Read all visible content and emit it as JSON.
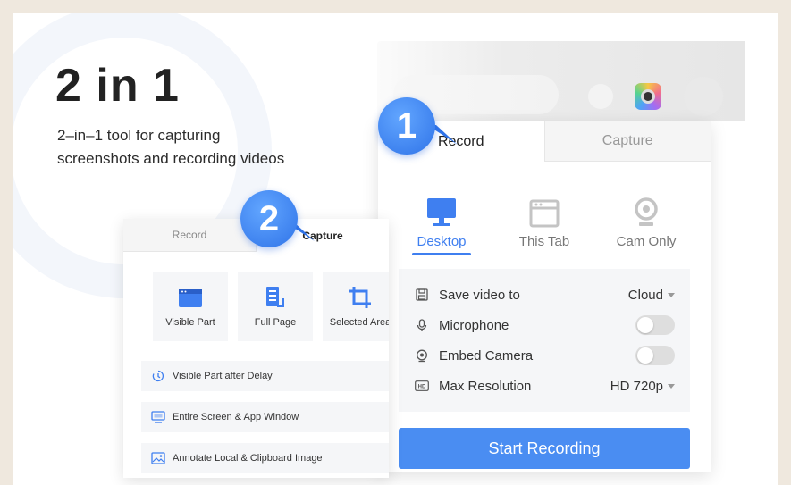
{
  "hero": {
    "title": "2 in 1",
    "subtitle_line1": "2–in–1 tool for capturing",
    "subtitle_line2": "screenshots and recording videos"
  },
  "badges": {
    "one": "1",
    "two": "2"
  },
  "record_popup": {
    "tabs": [
      {
        "label": "Record",
        "active": true
      },
      {
        "label": "Capture",
        "active": false
      }
    ],
    "modes": [
      {
        "label": "Desktop",
        "icon": "monitor-icon",
        "active": true
      },
      {
        "label": "This Tab",
        "icon": "browser-tab-icon",
        "active": false
      },
      {
        "label": "Cam Only",
        "icon": "webcam-icon",
        "active": false
      }
    ],
    "settings": [
      {
        "label": "Save video to",
        "value": "Cloud",
        "icon": "save-icon",
        "control": "dropdown"
      },
      {
        "label": "Microphone",
        "icon": "microphone-icon",
        "control": "toggle",
        "on": false
      },
      {
        "label": "Embed Camera",
        "icon": "camera-icon",
        "control": "toggle",
        "on": false
      },
      {
        "label": "Max Resolution",
        "value": "HD 720p",
        "icon": "hd-icon",
        "control": "dropdown"
      }
    ],
    "start_button": "Start Recording"
  },
  "capture_popup": {
    "tabs": [
      {
        "label": "Record",
        "active": false
      },
      {
        "label": "Capture",
        "active": true
      }
    ],
    "cards": [
      {
        "label": "Visible Part",
        "icon": "visible-part-icon"
      },
      {
        "label": "Full Page",
        "icon": "full-page-icon"
      },
      {
        "label": "Selected Area",
        "icon": "crop-icon"
      }
    ],
    "rows": [
      {
        "label": "Visible Part after Delay",
        "icon": "timer-icon"
      },
      {
        "label": "Entire Screen & App Window",
        "icon": "screen-icon"
      },
      {
        "label": "Annotate Local & Clipboard Image",
        "icon": "image-icon"
      }
    ]
  },
  "colors": {
    "accent": "#4a8df2",
    "badge": "#3b82f0",
    "panel": "#f5f6f8"
  }
}
